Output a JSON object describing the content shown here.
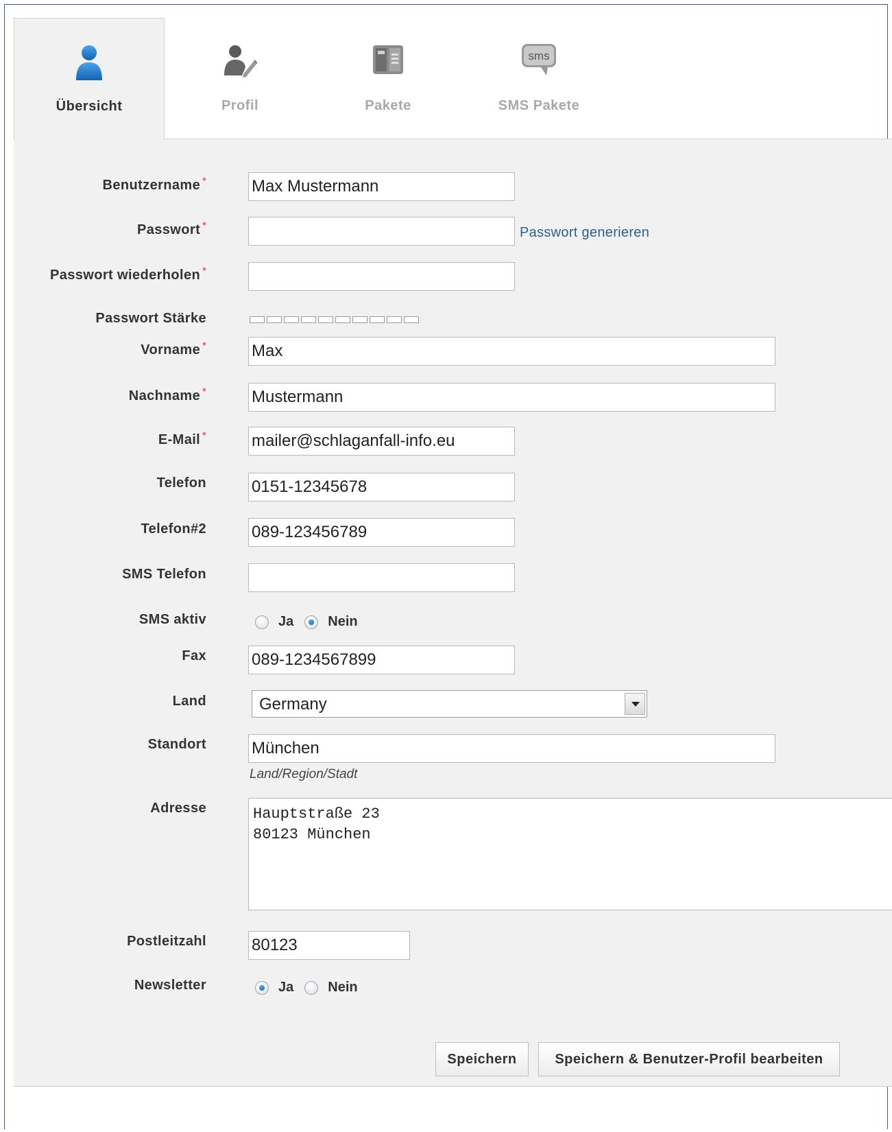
{
  "tabs": [
    {
      "label": "Übersicht",
      "icon": "user-icon",
      "active": true
    },
    {
      "label": "Profil",
      "icon": "user-edit-icon",
      "active": false
    },
    {
      "label": "Pakete",
      "icon": "package-icon",
      "active": false
    },
    {
      "label": "SMS Pakete",
      "icon": "sms-bubble-icon",
      "active": false,
      "icon_text": "sms"
    }
  ],
  "form": {
    "username": {
      "label": "Benutzername",
      "value": "Max Mustermann",
      "required": true
    },
    "password": {
      "label": "Passwort",
      "value": "",
      "required": true,
      "generate_link": "Passwort generieren"
    },
    "password_repeat": {
      "label": "Passwort wiederholen",
      "value": "",
      "required": true
    },
    "password_strength": {
      "label": "Passwort Stärke",
      "segments": 10,
      "filled": 0
    },
    "firstname": {
      "label": "Vorname",
      "value": "Max",
      "required": true
    },
    "lastname": {
      "label": "Nachname",
      "value": "Mustermann",
      "required": true
    },
    "email": {
      "label": "E-Mail",
      "value": "mailer@schlaganfall-info.eu",
      "required": true
    },
    "phone": {
      "label": "Telefon",
      "value": "0151-12345678"
    },
    "phone2": {
      "label": "Telefon#2",
      "value": "089-123456789"
    },
    "sms_phone": {
      "label": "SMS Telefon",
      "value": ""
    },
    "sms_active": {
      "label": "SMS aktiv",
      "options": [
        "Ja",
        "Nein"
      ],
      "selected": "Nein"
    },
    "fax": {
      "label": "Fax",
      "value": "089-1234567899"
    },
    "country": {
      "label": "Land",
      "value": "Germany"
    },
    "location": {
      "label": "Standort",
      "value": "München",
      "hint": "Land/Region/Stadt"
    },
    "address": {
      "label": "Adresse",
      "value": "Hauptstraße 23\n80123 München"
    },
    "zip": {
      "label": "Postleitzahl",
      "value": "80123"
    },
    "newsletter": {
      "label": "Newsletter",
      "options": [
        "Ja",
        "Nein"
      ],
      "selected": "Ja"
    }
  },
  "buttons": {
    "save": "Speichern",
    "save_edit": "Speichern & Benutzer-Profil bearbeiten"
  },
  "colors": {
    "accent": "#1e73c8",
    "link": "#2b5f8e",
    "required": "#e06060",
    "panel_bg": "#f1f1f1"
  }
}
